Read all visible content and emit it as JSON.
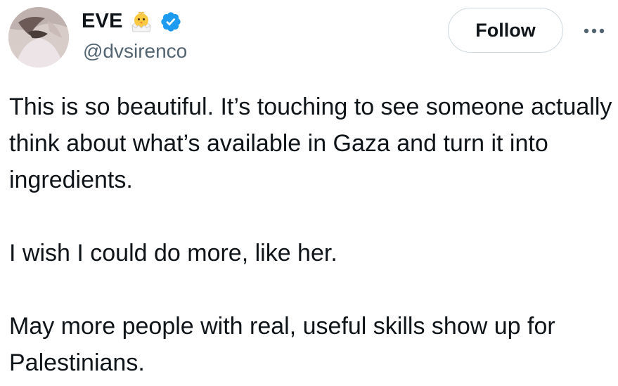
{
  "author": {
    "display_name": "EVE",
    "handle": "@dvsirenco",
    "name_emoji": "chick-emoji-icon",
    "verified": "verified-badge-icon"
  },
  "actions": {
    "follow_label": "Follow",
    "more_icon": "more-dots-icon"
  },
  "tweet": {
    "paragraphs": [
      "This is so beautiful. It’s touching to see someone actually think about what’s available in Gaza and turn it into ingredients.",
      "I wish I could do more, like her.",
      "May more people with real, useful skills show up for Palestinians."
    ]
  },
  "colors": {
    "text": "#0f1419",
    "secondary": "#536471",
    "verified": "#1d9bf0",
    "border": "#cfd9de"
  }
}
